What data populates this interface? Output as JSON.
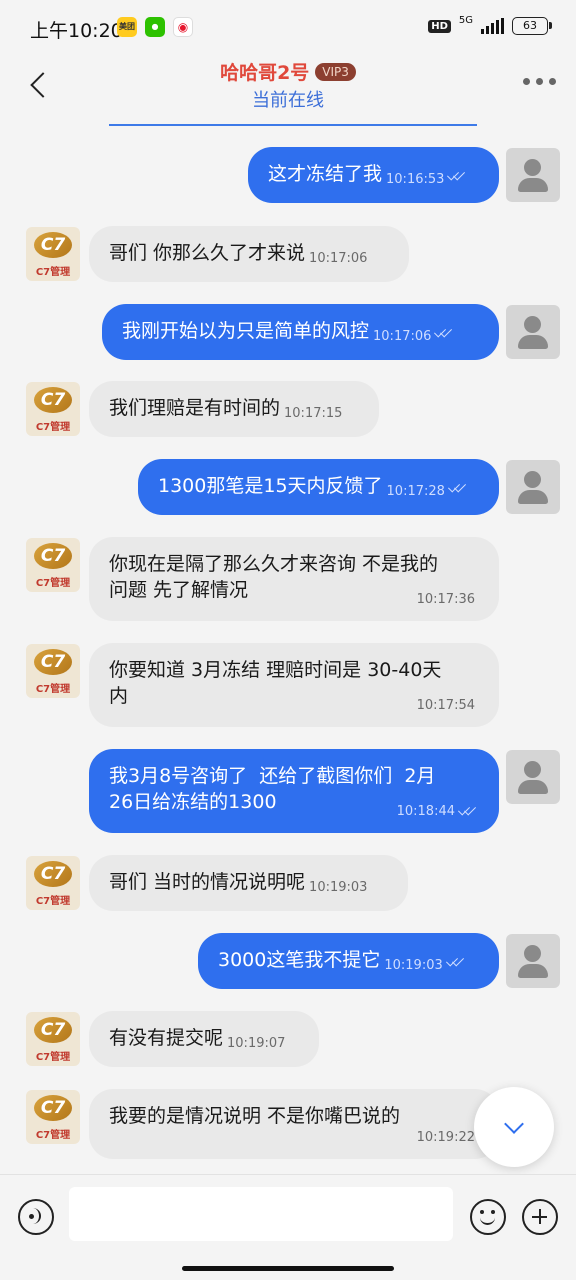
{
  "status_bar": {
    "time": "上午10:20",
    "apps": [
      {
        "name": "meituan-icon",
        "label": "美团"
      },
      {
        "name": "wechat-icon",
        "label": "微"
      },
      {
        "name": "weibo-icon",
        "label": "微"
      }
    ],
    "hd": "HD",
    "network": "5G",
    "battery": "63"
  },
  "header": {
    "name": "哈哈哥2号",
    "vip": "VIP3",
    "status": "当前在线"
  },
  "avatar_logo": {
    "mark": "C7",
    "brand": "C7管理"
  },
  "messages": [
    {
      "side": "me",
      "text": "这才冻结了我",
      "time": "10:16:53"
    },
    {
      "side": "them",
      "text": "哥们 你那么久了才来说",
      "time": "10:17:06"
    },
    {
      "side": "me",
      "text": "我刚开始以为只是简单的风控",
      "time": "10:17:06"
    },
    {
      "side": "them",
      "text": "我们理赔是有时间的",
      "time": "10:17:15"
    },
    {
      "side": "me",
      "text": "1300那笔是15天内反馈了",
      "time": "10:17:28"
    },
    {
      "side": "them",
      "text": "你现在是隔了那么久才来咨询 不是我的\n问题 先了解情况",
      "time": "10:17:36"
    },
    {
      "side": "them",
      "text": "你要知道 3月冻结 理赔时间是 30-40天\n内",
      "time": "10:17:54"
    },
    {
      "side": "me",
      "text": "我3月8号咨询了  还给了截图你们  2月\n26日给冻结的1300",
      "time": "10:18:44"
    },
    {
      "side": "them",
      "text": "哥们 当时的情况说明呢",
      "time": "10:19:03"
    },
    {
      "side": "me",
      "text": "3000这笔我不提它",
      "time": "10:19:03"
    },
    {
      "side": "them",
      "text": "有没有提交呢",
      "time": "10:19:07"
    },
    {
      "side": "them",
      "text": "我要的是情况说明 不是你嘴巴说的",
      "time": "10:19:22"
    }
  ],
  "input": {
    "placeholder": ""
  }
}
